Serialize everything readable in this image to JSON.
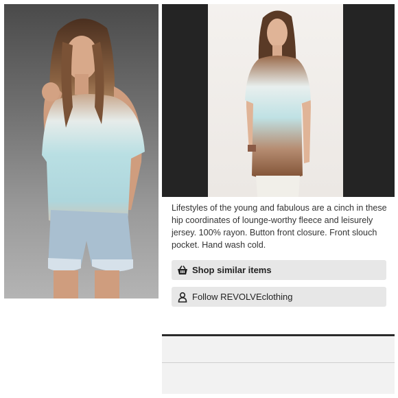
{
  "listing": {
    "description": "Lifestyles of the young and fabulous are a cinch in these hip coordinates of lounge-worthy fleece and leisurely jersey. 100% rayon. Button front closure. Front slouch pocket. Hand wash cold."
  },
  "actions": {
    "shop_label": "Shop similar items",
    "follow_label": "Follow REVOLVEclothing"
  },
  "icons": {
    "shop": "basket-icon",
    "follow": "person-icon"
  },
  "colors": {
    "button_bg": "#e7e7e7",
    "photo_right_bg": "#242424",
    "shirt_top": "#b9dde0",
    "shirt_bottom": "#8a5a3c"
  }
}
